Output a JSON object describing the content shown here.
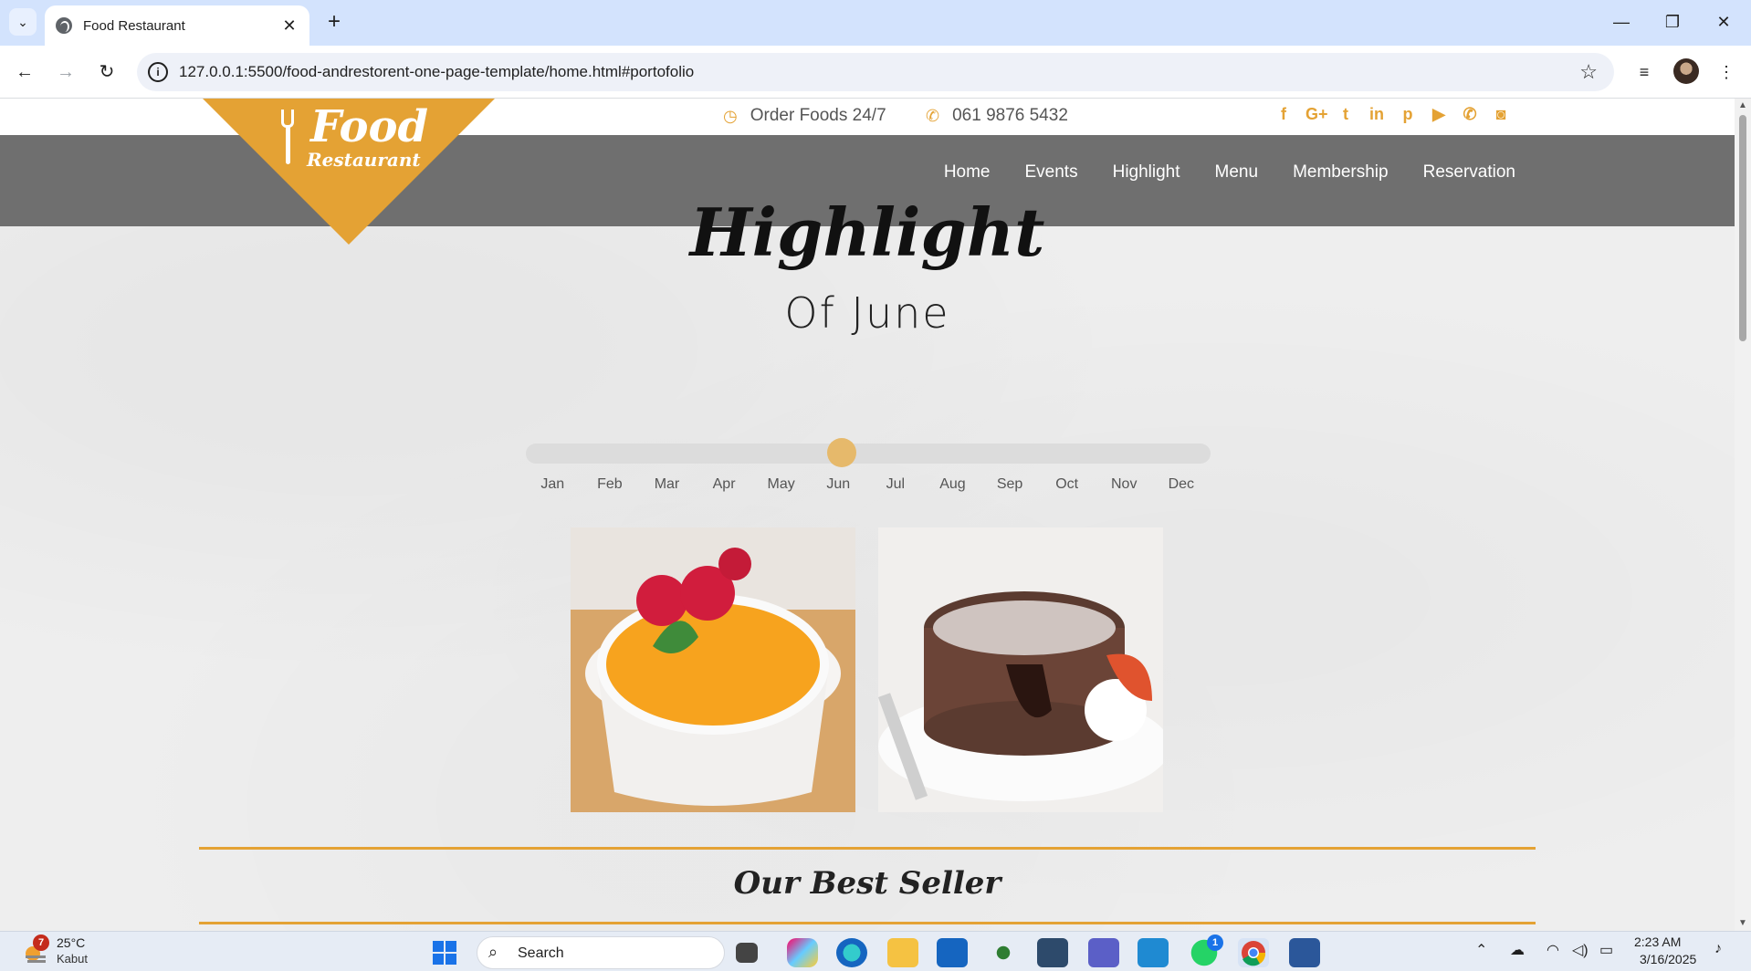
{
  "browser": {
    "tab_title": "Food Restaurant",
    "url": "127.0.0.1:5500/food-andrestorent-one-page-template/home.html#portofolio"
  },
  "site": {
    "logo_word1": "Food",
    "logo_word2": "Restaurant",
    "order_text": "Order Foods 24/7",
    "phone": "061 9876 5432",
    "social_icons": [
      "facebook-icon",
      "google-plus-icon",
      "twitter-icon",
      "linkedin-icon",
      "pinterest-icon",
      "youtube-icon",
      "phone-icon",
      "camera-icon"
    ],
    "nav": [
      "Home",
      "Events",
      "Highlight",
      "Menu",
      "Membership",
      "Reservation"
    ],
    "accent_color": "#e4a234"
  },
  "highlight": {
    "title": "Highlight",
    "subtitle": "Of June",
    "months": [
      "Jan",
      "Feb",
      "Mar",
      "Apr",
      "May",
      "Jun",
      "Jul",
      "Aug",
      "Sep",
      "Oct",
      "Nov",
      "Dec"
    ],
    "selected_month": "Jun",
    "selected_index": 5
  },
  "best_seller": {
    "title": "Our Best Seller"
  },
  "taskbar": {
    "weather_temp": "25°C",
    "weather_desc": "Kabut",
    "weather_badge": "7",
    "search_label": "Search",
    "whatsapp_badge": "1",
    "time": "2:23 AM",
    "date": "3/16/2025"
  }
}
